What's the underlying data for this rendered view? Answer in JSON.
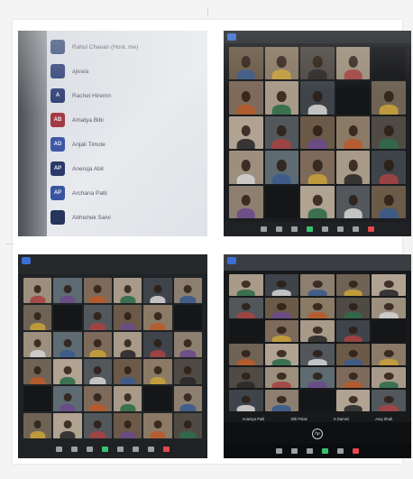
{
  "participants_panel": {
    "participants": [
      {
        "name": "Rahul Chavan (Host, me)",
        "initials": "",
        "color": "#3b4d7a"
      },
      {
        "name": "ajwala",
        "initials": "",
        "color": "#2d3f73"
      },
      {
        "name": "Rachel Hiremn",
        "initials": "A",
        "color": "#2d3f73"
      },
      {
        "name": "Amatya Bibi",
        "initials": "AB",
        "color": "#a33a44"
      },
      {
        "name": "Anjali Timule",
        "initials": "AD",
        "color": "#3d58a6"
      },
      {
        "name": "Aneruja Abil",
        "initials": "AP",
        "color": "#2a3a68"
      },
      {
        "name": "Archana Patil",
        "initials": "AP",
        "color": "#3a55a0"
      },
      {
        "name": "Abhishek Salvi",
        "initials": "",
        "color": "#27355c"
      }
    ]
  },
  "gallery_panels": [
    {
      "name": "gallery-top-right",
      "rows": 5,
      "cols": 5,
      "toolbar": [
        "",
        "",
        "",
        "",
        "",
        "",
        "",
        ""
      ]
    },
    {
      "name": "gallery-bottom-left",
      "rows": 6,
      "cols": 6,
      "toolbar": [
        "",
        "",
        "",
        "",
        "",
        "",
        "",
        ""
      ]
    },
    {
      "name": "gallery-bottom-right",
      "rows": 6,
      "cols": 5,
      "toolbar": [
        "",
        "",
        "",
        "",
        "",
        ""
      ]
    }
  ],
  "bottom_right_names": [
    "Anantya Patil",
    "Sitli Pelas",
    "S Damini",
    "Anuj Shah"
  ],
  "laptop_logo": "hp",
  "colors": {
    "zoom_bg": "#1b1d20",
    "zoom_toolbar": "#1f2124",
    "panel_light": "#e8eaee",
    "accent_blue": "#3b6fd1"
  }
}
